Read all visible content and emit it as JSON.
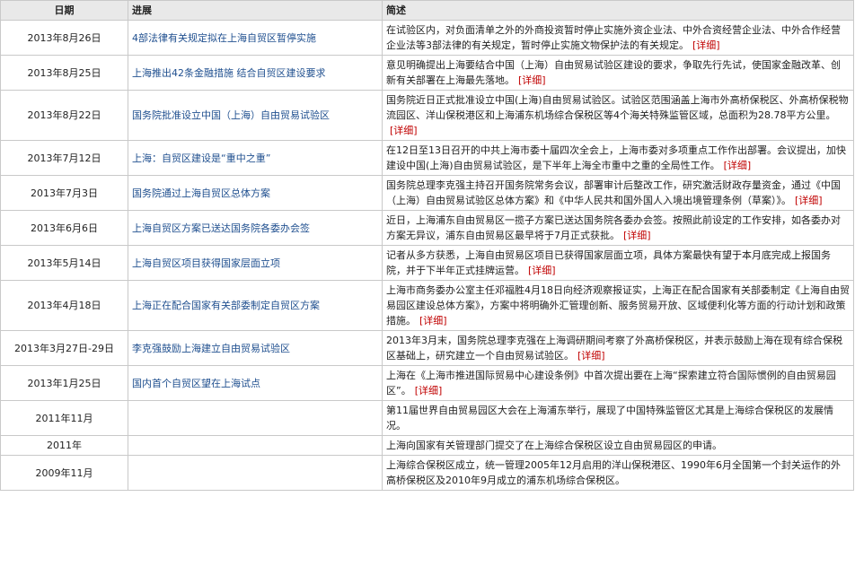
{
  "header": {
    "date": "日期",
    "progress": "进展",
    "summary": "简述"
  },
  "more_label": "[详细]",
  "rows": [
    {
      "date": "2013年8月26日",
      "progress": "4部法律有关规定拟在上海自贸区暂停实施",
      "summary": "在试验区内，对负面清单之外的外商投资暂时停止实施外资企业法、中外合资经营企业法、中外合作经营企业法等3部法律的有关规定，暂时停止实施文物保护法的有关规定。",
      "more": true
    },
    {
      "date": "2013年8月25日",
      "progress": "上海推出42条金融措施  结合自贸区建设要求",
      "summary": "意见明确提出上海要结合中国（上海）自由贸易试验区建设的要求，争取先行先试，使国家金融改革、创新有关部署在上海最先落地。",
      "more": true
    },
    {
      "date": "2013年8月22日",
      "progress": "国务院批准设立中国（上海）自由贸易试验区",
      "summary": "国务院近日正式批准设立中国(上海)自由贸易试验区。试验区范围涵盖上海市外高桥保税区、外高桥保税物流园区、洋山保税港区和上海浦东机场综合保税区等4个海关特殊监管区域，总面积为28.78平方公里。",
      "more": true
    },
    {
      "date": "2013年7月12日",
      "progress": "上海：自贸区建设是“重中之重”",
      "summary": "在12日至13日召开的中共上海市委十届四次全会上，上海市委对多项重点工作作出部署。会议提出，加快建设中国(上海)自由贸易试验区，是下半年上海全市重中之重的全局性工作。",
      "more": true
    },
    {
      "date": "2013年7月3日",
      "progress": "国务院通过上海自贸区总体方案",
      "summary": "国务院总理李克强主持召开国务院常务会议，部署审计后整改工作，研究激活财政存量资金，通过《中国（上海）自由贸易试验区总体方案》和《中华人民共和国外国人入境出境管理条例（草案）》。",
      "more": true
    },
    {
      "date": "2013年6月6日",
      "progress": "上海自贸区方案已送达国务院各委办会签",
      "summary": "近日，上海浦东自由贸易区一揽子方案已送达国务院各委办会签。按照此前设定的工作安排，如各委办对方案无异议，浦东自由贸易区最早将于7月正式获批。",
      "more": true
    },
    {
      "date": "2013年5月14日",
      "progress": "上海自贸区项目获得国家层面立项",
      "summary": "记者从多方获悉，上海自由贸易区项目已获得国家层面立项，具体方案最快有望于本月底完成上报国务院，并于下半年正式挂牌运营。",
      "more": true
    },
    {
      "date": "2013年4月18日",
      "progress": "上海正在配合国家有关部委制定自贸区方案",
      "summary": "上海市商务委办公室主任邓福胜4月18日向经济观察报证实，上海正在配合国家有关部委制定《上海自由贸易园区建设总体方案》，方案中将明确外汇管理创新、服务贸易开放、区域便利化等方面的行动计划和政策措施。",
      "more": true
    },
    {
      "date": "2013年3月27日-29日",
      "progress": "李克强鼓励上海建立自由贸易试验区",
      "summary": "2013年3月末，国务院总理李克强在上海调研期间考察了外高桥保税区，并表示鼓励上海在现有综合保税区基础上，研究建立一个自由贸易试验区。",
      "more": true
    },
    {
      "date": "2013年1月25日",
      "progress": "国内首个自贸区望在上海试点",
      "summary": "上海在《上海市推进国际贸易中心建设条例》中首次提出要在上海“探索建立符合国际惯例的自由贸易园区”。",
      "more": true
    },
    {
      "date": "2011年11月",
      "progress": "",
      "summary": "第11届世界自由贸易园区大会在上海浦东举行，展现了中国特殊监管区尤其是上海综合保税区的发展情况。",
      "more": false
    },
    {
      "date": "2011年",
      "progress": "",
      "summary": "上海向国家有关管理部门提交了在上海综合保税区设立自由贸易园区的申请。",
      "more": false
    },
    {
      "date": "2009年11月",
      "progress": "",
      "summary": "上海综合保税区成立，统一管理2005年12月启用的洋山保税港区、1990年6月全国第一个封关运作的外高桥保税区及2010年9月成立的浦东机场综合保税区。",
      "more": false
    }
  ]
}
